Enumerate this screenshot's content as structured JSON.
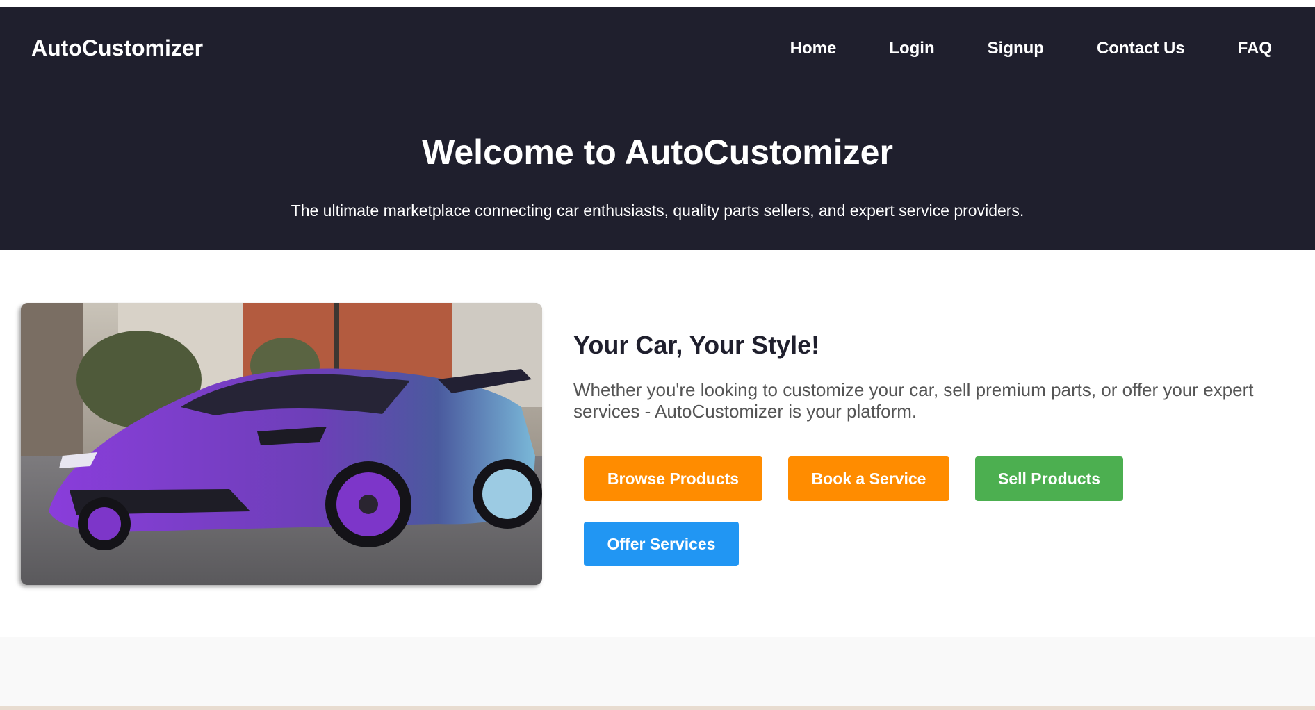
{
  "header": {
    "brand": "AutoCustomizer",
    "nav": [
      "Home",
      "Login",
      "Signup",
      "Contact Us",
      "FAQ"
    ]
  },
  "hero": {
    "title": "Welcome to AutoCustomizer",
    "subtitle": "The ultimate marketplace connecting car enthusiasts, quality parts sellers, and expert service providers."
  },
  "feature": {
    "title": "Your Car, Your Style!",
    "text": "Whether you're looking to customize your car, sell premium parts, or offer your expert services - AutoCustomizer is your platform.",
    "buttons": {
      "browse": "Browse Products",
      "book": "Book a Service",
      "sell": "Sell Products",
      "offer": "Offer Services"
    }
  },
  "colors": {
    "header_bg": "#1f1f2d",
    "orange": "#ff8c00",
    "green": "#4caf50",
    "blue": "#2196f3",
    "car_purple": "#8b3fd9"
  }
}
